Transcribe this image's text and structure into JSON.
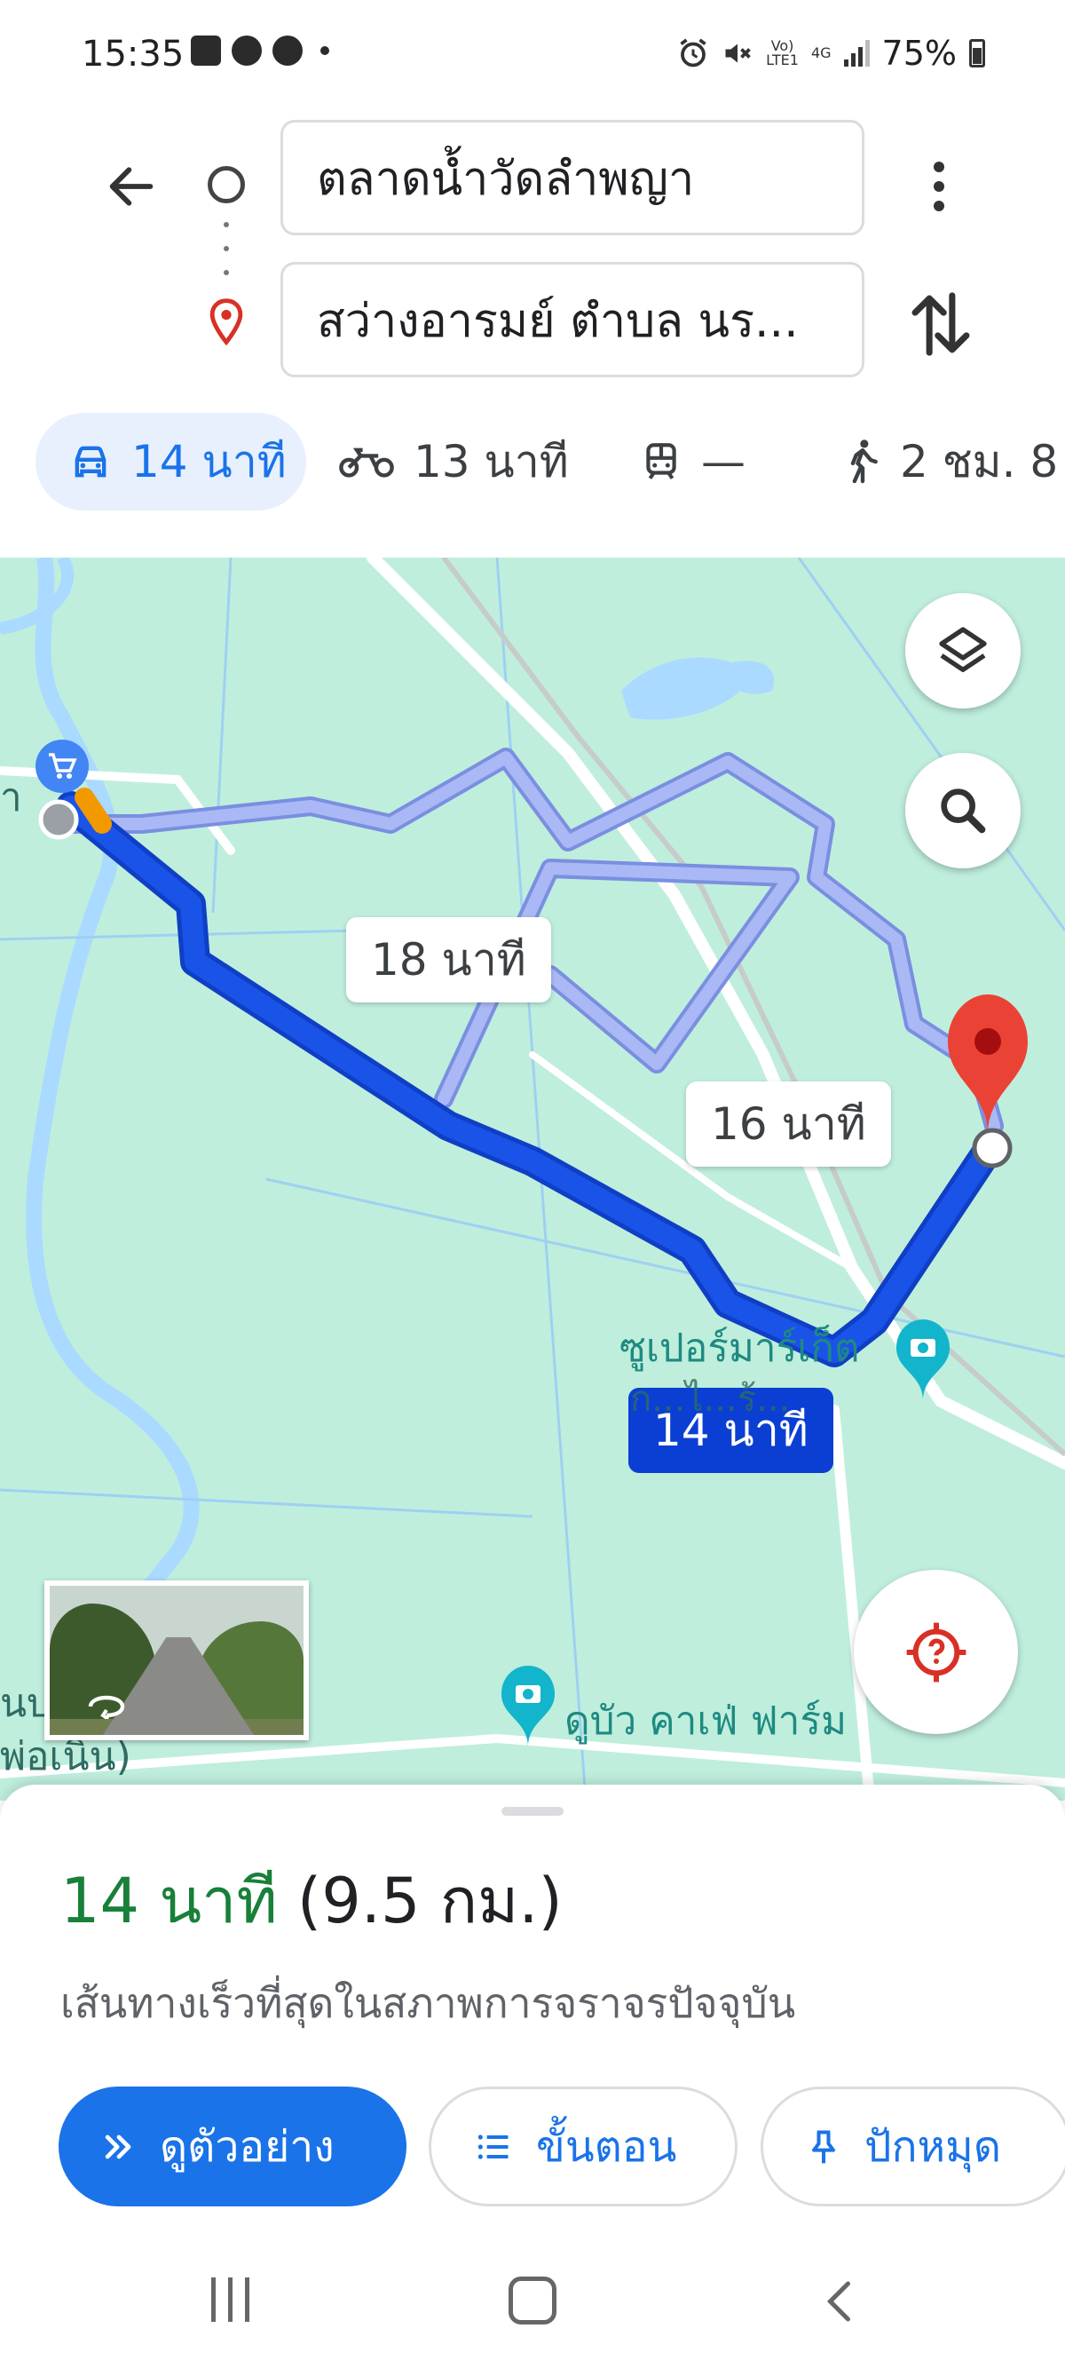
{
  "status_bar": {
    "time": "15:35",
    "network_top": "Vo)",
    "network_bottom": "LTE1",
    "network_type": "4G",
    "battery": "75%"
  },
  "header": {
    "origin": "ตลาดน้ำวัดลำพญา",
    "destination": "สว่างอารมย์ ตำบล นร..."
  },
  "modes": [
    {
      "icon": "car-icon",
      "label": "14 นาที",
      "active": true
    },
    {
      "icon": "motorcycle-icon",
      "label": "13 นาที",
      "active": false
    },
    {
      "icon": "transit-icon",
      "label": "—",
      "active": false
    },
    {
      "icon": "walking-icon",
      "label": "2 ชม. 8",
      "active": false
    }
  ],
  "map": {
    "route_labels": {
      "alt_1": "18 นาที",
      "alt_2": "16 นาที",
      "main": "14 นาที"
    },
    "pois": {
      "supermarket_line1": "ซูเปอร์มาร์เก็ต",
      "supermarket_line2": "ก...ไ...ร้...",
      "cafe": "ดูบัว คาเฟ่ ฟาร์ม",
      "edge_top": "า",
      "edge_left_1": "นบ",
      "edge_left_2": "พ่อเนิน)"
    },
    "colors": {
      "water": "#aadaff",
      "land": "#bfeedd",
      "main_route": "#1a53e8",
      "alt_route": "#aab8f5",
      "destination_pin": "#ea4335"
    }
  },
  "sheet": {
    "duration": "14 นาที",
    "distance": "(9.5 กม.)",
    "subtitle": "เส้นทางเร็วที่สุดในสภาพการจราจรปัจจุบัน",
    "preview_label": "ดูตัวอย่าง",
    "steps_label": "ขั้นตอน",
    "pin_label": "ปักหมุด"
  }
}
